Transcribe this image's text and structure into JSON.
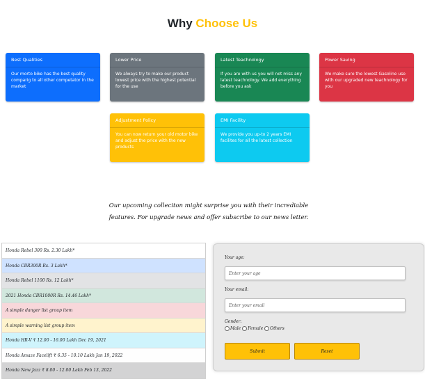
{
  "heading": {
    "prefix": "Why ",
    "highlight": "Choose Us"
  },
  "cards": [
    {
      "title": "Best Qualities",
      "text": "Our morto bike has the best quality comparig to all other competator in the market"
    },
    {
      "title": "Lower Price",
      "text": "We always try to make our product lowest price with the highest potential for the use"
    },
    {
      "title": "Latest Teachnology",
      "text": "If you are with us you will not miss any latest teachnology. We add everything before you ask"
    },
    {
      "title": "Power Saving",
      "text": "We make sure the lowest Gasoline use with our upgraded new teachnology for you"
    },
    {
      "title": "Adjustment Policy",
      "text": "You can now return your old motor bike and adjust the price with the new products"
    },
    {
      "title": "EMI Facility",
      "text": "We provide you up-to 2 years EMI facilites for all the latest collection"
    }
  ],
  "tagline": {
    "line1": "Our upcoming colleciton might surprise you with their incrediable",
    "line2": "features. For upgrade news and offer subscribe to our news letter."
  },
  "list_items": [
    "Honda Rebel 300 Rs. 2.30 Lakh*",
    "Honda CBR300R Rs. 3 Lakh*",
    "Honda Rebel 1100 Rs. 12 Lakh*",
    "2021 Honda CBR1000R Rs. 14.46 Lakh*",
    "A simple danger list group item",
    "A simple warning list group item",
    "Honda HR-V ₹ 12.00 - 16.00 Lakh Dec 19, 2021",
    "Honda Amaze Facelift ₹ 6.35 - 10.10 Lakh Jan 19, 2022",
    "Honda New Jazz ₹ 8.00 - 12.00 Lakh Feb 13, 2022"
  ],
  "list_colors": [
    "#ffffff",
    "#cfe2ff",
    "#e2e3e5",
    "#d1e7dd",
    "#f8d7da",
    "#fff3cd",
    "#cff4fc",
    "#fefefe",
    "#d3d3d4"
  ],
  "form": {
    "age_label": "Your age:",
    "age_placeholder": "Enter your age",
    "email_label": "Your email:",
    "email_placeholder": "Enter your email",
    "gender_label": "Gender:",
    "gender_options": [
      "Male",
      "Female",
      "Others"
    ],
    "submit_label": "Submit",
    "reset_label": "Reset"
  }
}
